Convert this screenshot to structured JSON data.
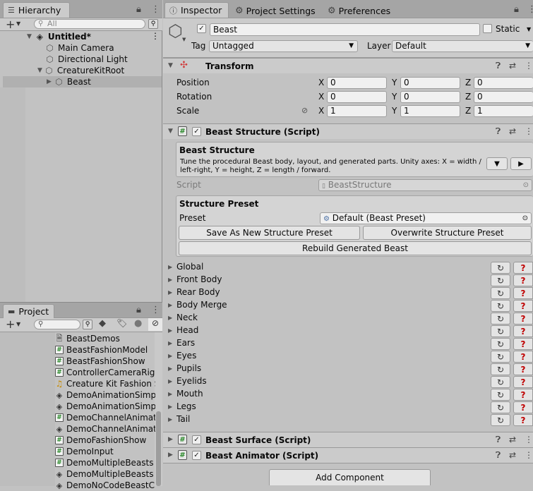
{
  "hierarchy": {
    "tab_label": "Hierarchy",
    "search_placeholder": "All",
    "scene_name": "Untitled*",
    "items": [
      {
        "label": "Main Camera"
      },
      {
        "label": "Directional Light"
      },
      {
        "label": "CreatureKitRoot"
      },
      {
        "label": "Beast"
      }
    ]
  },
  "project": {
    "tab_label": "Project",
    "hidden_count": "",
    "items": [
      {
        "label": "BeastDemos",
        "icon": "document-icon"
      },
      {
        "label": "BeastFashionModel",
        "icon": "script-icon"
      },
      {
        "label": "BeastFashionShow",
        "icon": "script-icon"
      },
      {
        "label": "ControllerCameraRig",
        "icon": "script-icon"
      },
      {
        "label": "Creature Kit Fashion S",
        "icon": "audio-icon"
      },
      {
        "label": "DemoAnimationSimple",
        "icon": "scene-icon"
      },
      {
        "label": "DemoAnimationSimple",
        "icon": "scene-icon"
      },
      {
        "label": "DemoChannelAnimatio",
        "icon": "script-icon"
      },
      {
        "label": "DemoChannelAnimatio",
        "icon": "scene-icon"
      },
      {
        "label": "DemoFashionShow",
        "icon": "script-icon"
      },
      {
        "label": "DemoInput",
        "icon": "script-icon"
      },
      {
        "label": "DemoMultipleBeasts",
        "icon": "script-icon"
      },
      {
        "label": "DemoMultipleBeasts",
        "icon": "scene-icon"
      },
      {
        "label": "DemoNoCodeBeastC",
        "icon": "scene-icon"
      }
    ]
  },
  "inspector": {
    "tabs": [
      {
        "label": "Inspector"
      },
      {
        "label": "Project Settings"
      },
      {
        "label": "Preferences"
      }
    ],
    "object_name": "Beast",
    "static_label": "Static",
    "tag_label": "Tag",
    "tag_value": "Untagged",
    "layer_label": "Layer",
    "layer_value": "Default",
    "transform": {
      "title": "Transform",
      "position_label": "Position",
      "rotation_label": "Rotation",
      "scale_label": "Scale",
      "axis_x": "X",
      "axis_y": "Y",
      "axis_z": "Z",
      "position": [
        "0",
        "0",
        "0"
      ],
      "rotation": [
        "0",
        "0",
        "0"
      ],
      "scale": [
        "1",
        "1",
        "1"
      ]
    },
    "structure": {
      "title": "Beast Structure (Script)",
      "box_title": "Beast Structure",
      "box_desc_1": "Tune the procedural Beast body, layout, and generated parts. Unity axes: X = width /",
      "box_desc_2": "left-right, Y = height, Z = length / forward.",
      "script_label": "Script",
      "script_value": "BeastStructure",
      "preset_box_title": "Structure Preset",
      "preset_label": "Preset",
      "preset_value": "Default (Beast Preset)",
      "save_preset": "Save As New Structure Preset",
      "overwrite_preset": "Overwrite Structure Preset",
      "rebuild": "Rebuild Generated Beast",
      "sections": [
        "Global",
        "Front Body",
        "Rear Body",
        "Body Merge",
        "Neck",
        "Head",
        "Ears",
        "Eyes",
        "Pupils",
        "Eyelids",
        "Mouth",
        "Legs",
        "Tail"
      ],
      "help_glyph": "?"
    },
    "surface_title": "Beast Surface (Script)",
    "animator_title": "Beast Animator (Script)",
    "add_component": "Add Component"
  },
  "colors": {
    "panel_bg": "#c2c2c2",
    "header_bg": "#cbcbcb",
    "selection": "#b0b0b0",
    "help_red": "#c00000",
    "script_green": "#2b8a2b"
  }
}
